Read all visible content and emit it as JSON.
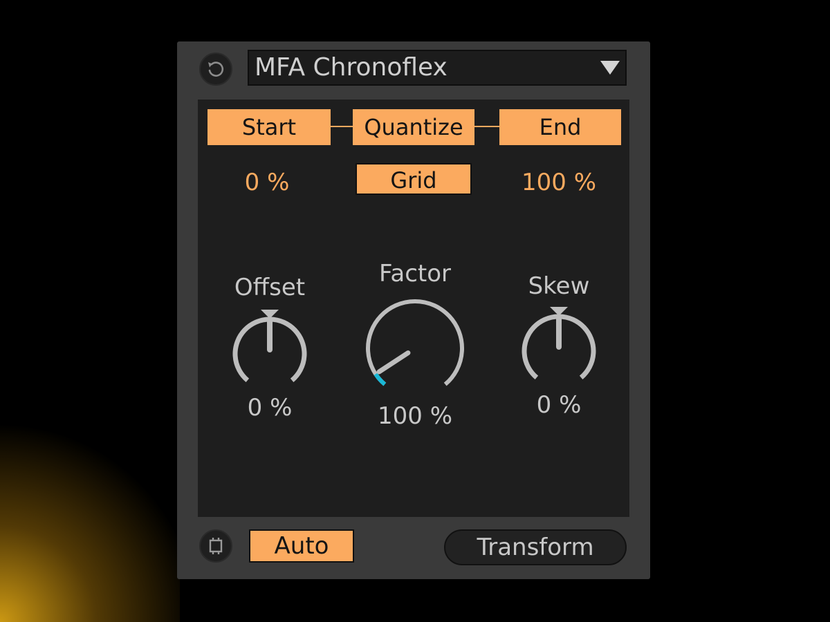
{
  "device": {
    "preset_name": "MFA Chronoflex",
    "buttons": {
      "start": "Start",
      "quantize": "Quantize",
      "end": "End",
      "grid": "Grid",
      "auto": "Auto",
      "transform": "Transform"
    },
    "values": {
      "start": "0 %",
      "end": "100 %"
    },
    "knobs": [
      {
        "label": "Offset",
        "value": "0 %",
        "level": 0.5,
        "icon": "knob-bipolar"
      },
      {
        "label": "Factor",
        "value": "100 %",
        "level": 0.06,
        "icon": "knob-unipolar"
      },
      {
        "label": "Skew",
        "value": "0 %",
        "level": 0.5,
        "icon": "knob-bipolar"
      }
    ],
    "icons": {
      "reset": "reset-icon",
      "preset_dropdown": "chevron-down-icon",
      "hot_swap": "hot-swap-icon"
    }
  },
  "colors": {
    "accent": "#fbaa5f",
    "knob_ring": "#bdbdbd",
    "knob_fill": "#1ab8d6",
    "panel_bg": "#1e1e1e",
    "device_bg": "#3a3a3a"
  }
}
